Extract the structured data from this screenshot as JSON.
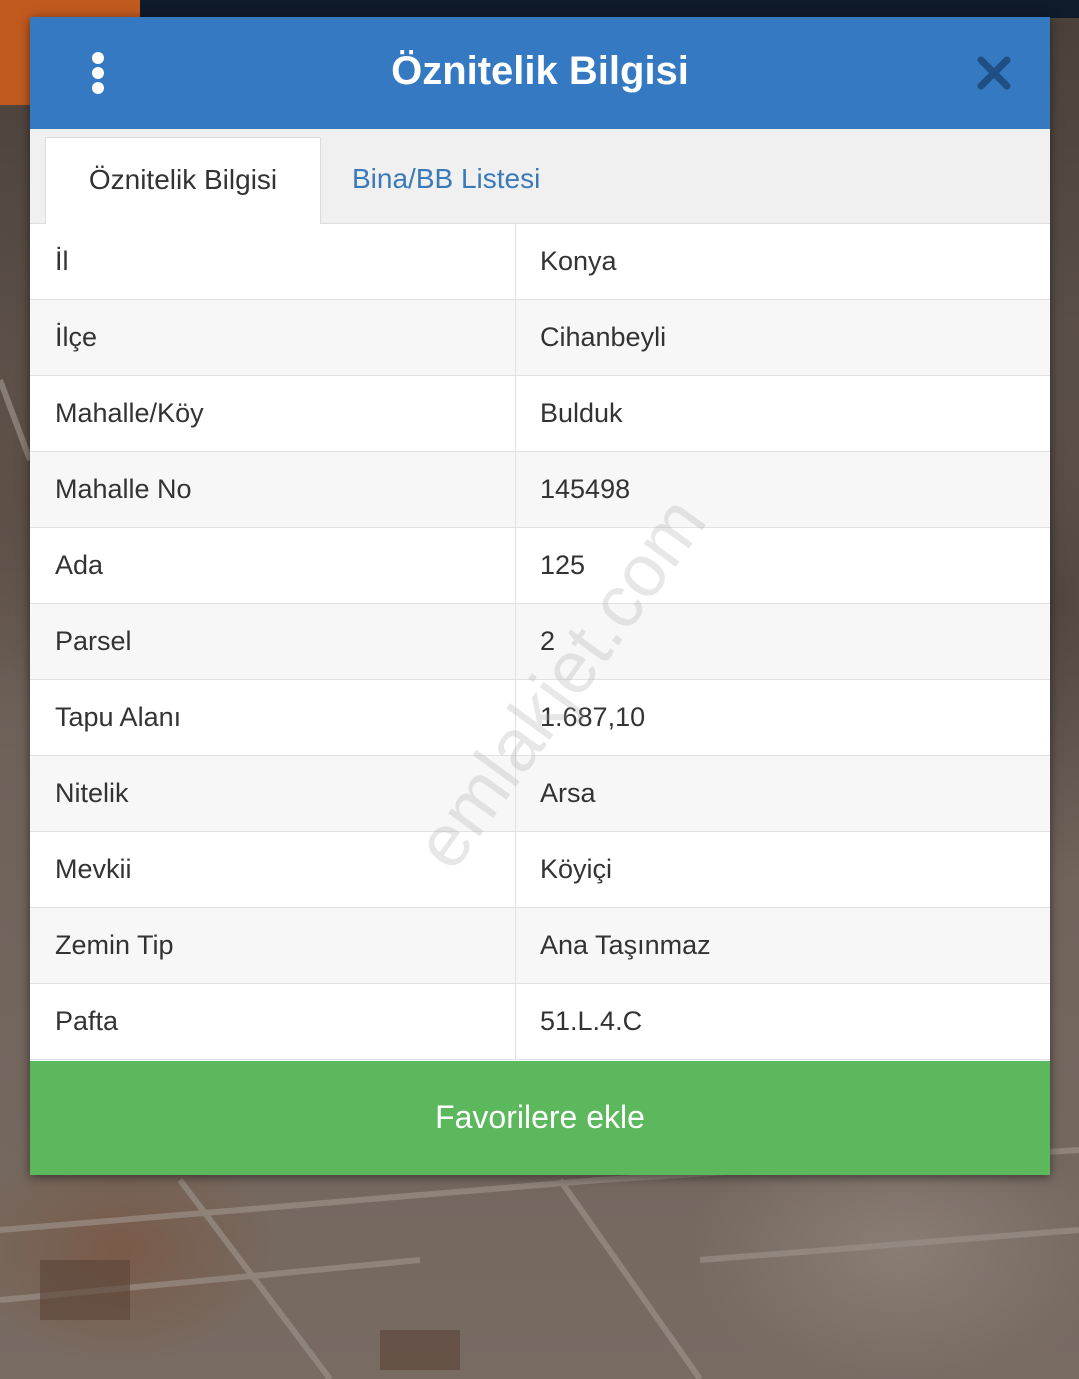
{
  "dialog": {
    "title": "Öznitelik Bilgisi",
    "menu_icon": "vertical-dots-icon",
    "close_icon": "close-icon"
  },
  "tabs": [
    {
      "label": "Öznitelik Bilgisi",
      "active": true
    },
    {
      "label": "Bina/BB Listesi",
      "active": false
    }
  ],
  "attributes": [
    {
      "key": "İl",
      "value": "Konya"
    },
    {
      "key": "İlçe",
      "value": "Cihanbeyli"
    },
    {
      "key": "Mahalle/Köy",
      "value": "Bulduk"
    },
    {
      "key": "Mahalle No",
      "value": "145498"
    },
    {
      "key": "Ada",
      "value": "125"
    },
    {
      "key": "Parsel",
      "value": "2"
    },
    {
      "key": "Tapu Alanı",
      "value": "1.687,10"
    },
    {
      "key": "Nitelik",
      "value": "Arsa"
    },
    {
      "key": "Mevkii",
      "value": "Köyiçi"
    },
    {
      "key": "Zemin Tip",
      "value": "Ana Taşınmaz"
    },
    {
      "key": "Pafta",
      "value": "51.L.4.C"
    }
  ],
  "favorite_button": {
    "label": "Favorilere ekle"
  },
  "watermark": "emlakjet.com",
  "colors": {
    "header": "#3479c1",
    "tab_link": "#3a7ab8",
    "button": "#5cb85c"
  }
}
